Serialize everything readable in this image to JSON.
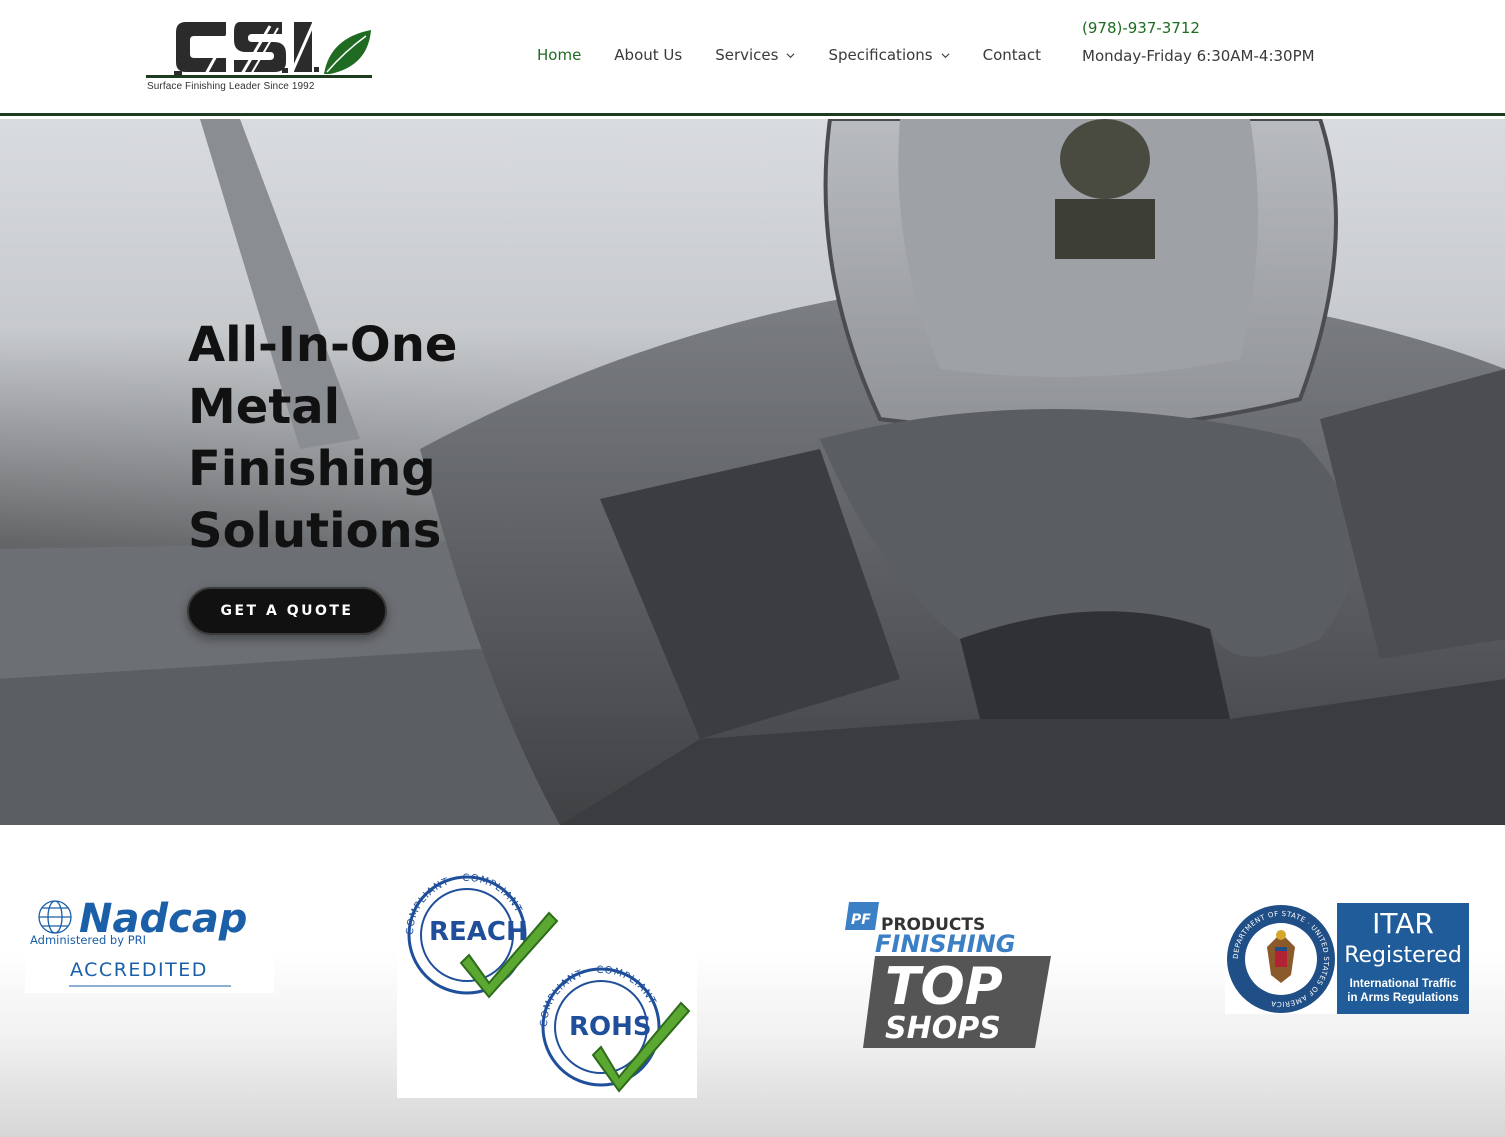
{
  "header": {
    "logo_text": "CSI",
    "tagline": "Surface Finishing Leader Since 1992",
    "nav": [
      {
        "label": "Home",
        "active": true,
        "dropdown": false
      },
      {
        "label": "About Us",
        "active": false,
        "dropdown": false
      },
      {
        "label": "Services",
        "active": false,
        "dropdown": true
      },
      {
        "label": "Specifications",
        "active": false,
        "dropdown": true
      },
      {
        "label": "Contact",
        "active": false,
        "dropdown": false
      }
    ],
    "phone": "(978)-937-3712",
    "hours": "Monday-Friday 6:30AM-4:30PM"
  },
  "hero": {
    "title_lines": [
      "All-In-One",
      "Metal",
      "Finishing",
      "Solutions"
    ],
    "cta_label": "GET A QUOTE"
  },
  "certifications": {
    "nadcap": {
      "brand": "Nadcap",
      "sub": "Administered by PRI",
      "status": "ACCREDITED"
    },
    "reach_rohs": {
      "ring_text": "COMPLIANT · COMPLIANT ·",
      "reach": "REACH",
      "rohs": "ROHS"
    },
    "top_shops": {
      "pf": "PF",
      "line1": "PRODUCTS",
      "line2": "FINISHING",
      "line3": "TOP",
      "line4": "SHOPS"
    },
    "itar": {
      "seal_text": "DEPARTMENT OF STATE · UNITED STATES OF AMERICA",
      "title1": "ITAR",
      "title2": "Registered",
      "sub1": "International Traffic",
      "sub2": "in Arms Regulations"
    }
  },
  "colors": {
    "brand_green": "#1f6b22",
    "header_border": "#1c3b1f",
    "cta_bg": "#111111",
    "nadcap_blue": "#1a5fa8",
    "itar_blue": "#1f5c99",
    "check_green": "#5aa832"
  }
}
